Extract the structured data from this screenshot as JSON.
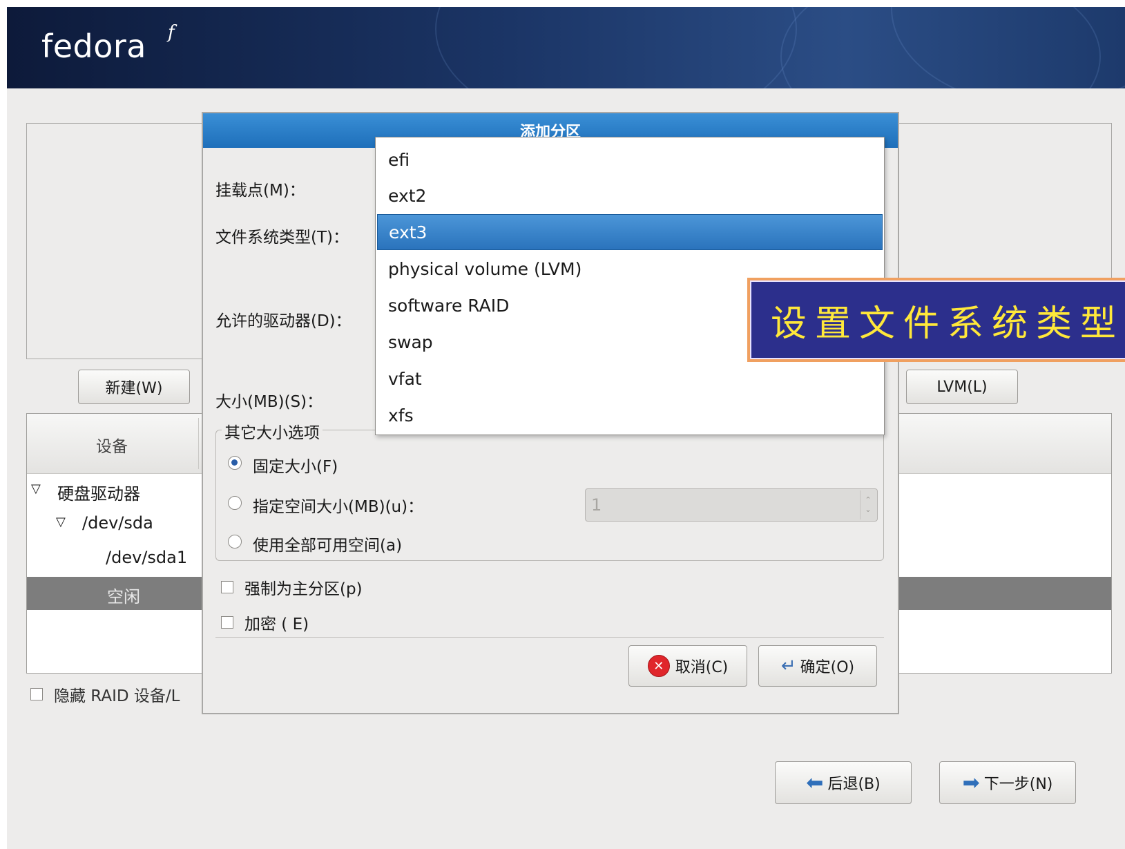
{
  "brand": {
    "logo_text": "fedora",
    "logo_mark": "f"
  },
  "background_screen": {
    "new_button": "新建(W)",
    "lvm_button": "LVM(L)",
    "tree_header_device": "设备",
    "tree": {
      "hard_drives": "硬盘驱动器",
      "dev_sda": "/dev/sda",
      "dev_sda1": "/dev/sda1",
      "free": "空闲"
    },
    "hide_raid_label": "隐藏 RAID 设备/L"
  },
  "dialog": {
    "title": "添加分区",
    "mount_point_label": "挂载点(M)：",
    "fs_type_label": "文件系统类型(T)：",
    "allowed_drives_label": "允许的驱动器(D)：",
    "size_label": "大小(MB)(S)：",
    "other_size_options": "其它大小选项",
    "fixed_size": "固定大小(F)",
    "fill_to_size": "指定空间大小(MB)(u)：",
    "fill_all": "使用全部可用空间(a)",
    "fill_to_size_value": "1",
    "force_primary": "强制为主分区(p)",
    "encrypt": "加密 ( E)",
    "cancel_button": "取消(C)",
    "ok_button": "确定(O)",
    "selected_option": "fixed_size"
  },
  "fs_dropdown": {
    "options": [
      "efi",
      "ext2",
      "ext3",
      "physical volume (LVM)",
      "software RAID",
      "swap",
      "vfat",
      "xfs"
    ],
    "selected": "ext3"
  },
  "callout": {
    "text": "设置文件系统类型"
  },
  "nav": {
    "back_button": "后退(B)",
    "next_button": "下一步(N)"
  },
  "colors": {
    "accent": "#2a73bc",
    "callout_bg": "#2c2f8c",
    "callout_text": "#ffe83a"
  }
}
